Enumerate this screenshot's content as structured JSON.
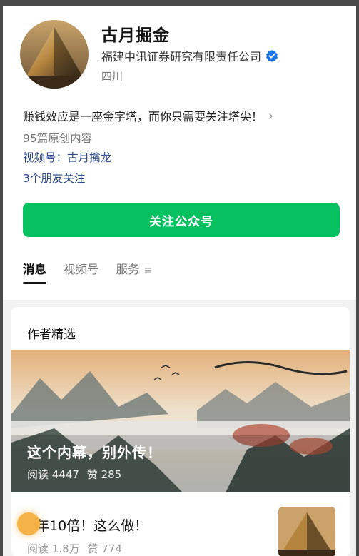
{
  "account": {
    "name": "古月掘金",
    "company": "福建中讯证券研究有限责任公司",
    "location": "四川",
    "description": "赚钱效应是一座金字塔，而你只需要关注塔尖！",
    "articles": "95篇原创内容",
    "channel": "视频号：古月擒龙",
    "friends": "3个朋友关注"
  },
  "actions": {
    "follow_label": "关注公众号"
  },
  "tabs": [
    {
      "label": "消息",
      "active": true
    },
    {
      "label": "视频号",
      "active": false
    },
    {
      "label": "服务",
      "active": false
    }
  ],
  "featured": {
    "section_title": "作者精选",
    "items": [
      {
        "title": "这个内幕，别外传！",
        "reads_label": "阅读",
        "reads": "4447",
        "likes_label": "赞",
        "likes": "285"
      },
      {
        "title": "2年10倍！这么做！",
        "reads_label": "阅读",
        "reads": "1.8万",
        "likes_label": "赞",
        "likes": "774"
      }
    ]
  },
  "colors": {
    "accent_green": "#07c160",
    "link_blue": "#2d4a8a",
    "verified_blue": "#1a73e8"
  },
  "icons": [
    "verified-icon",
    "chevron-right-icon",
    "menu-icon"
  ]
}
